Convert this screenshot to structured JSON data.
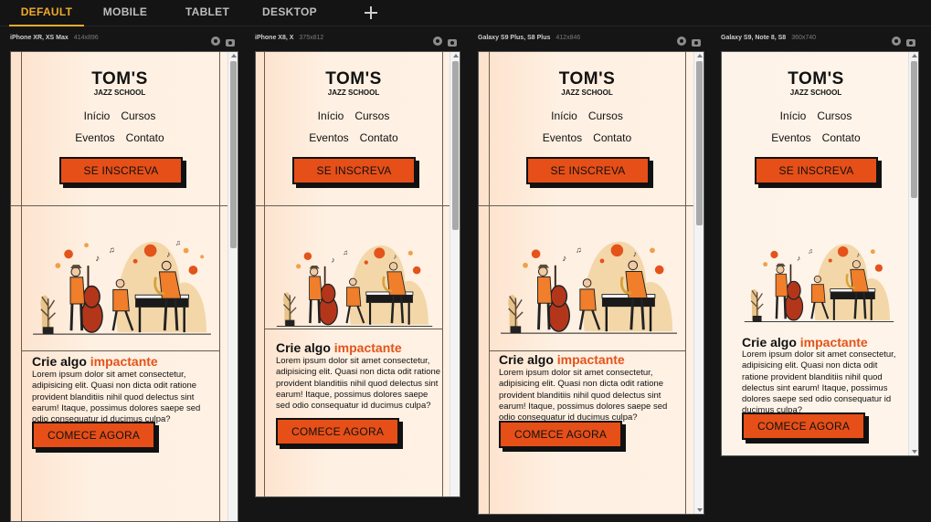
{
  "tabs": [
    {
      "label": "DEFAULT",
      "active": true
    },
    {
      "label": "MOBILE",
      "active": false
    },
    {
      "label": "TABLET",
      "active": false
    },
    {
      "label": "DESKTOP",
      "active": false
    }
  ],
  "devices": [
    {
      "name": "iPhone XR, XS Max",
      "size": "414x896"
    },
    {
      "name": "iPhone X8, X",
      "size": "375x812"
    },
    {
      "name": "Galaxy S9 Plus, S8 Plus",
      "size": "412x846"
    },
    {
      "name": "Galaxy S9, Note 8, S8",
      "size": "360x740"
    }
  ],
  "site": {
    "brand_title": "TOM'S",
    "brand_subtitle": "JAZZ SCHOOL",
    "nav_row1": [
      "Início",
      "Cursos"
    ],
    "nav_row2": [
      "Eventos",
      "Contato"
    ],
    "signup_button": "SE INSCREVA",
    "heading_plain": "Crie algo ",
    "heading_accent": "impactante",
    "paragraph": "Lorem ipsum dolor sit amet consectetur, adipisicing elit. Quasi non dicta odit ratione provident blanditiis nihil quod delectus sint earum! Itaque, possimus dolores saepe sed odio consequatur id ducimus culpa?",
    "start_button": "COMECE AGORA"
  },
  "colors": {
    "accent": "#f0a92e",
    "button": "#e64f18",
    "heading_accent": "#e4531a",
    "page_bg": "#fff1e4"
  },
  "icons": [
    "gear-icon",
    "camera-icon",
    "plus-icon"
  ]
}
